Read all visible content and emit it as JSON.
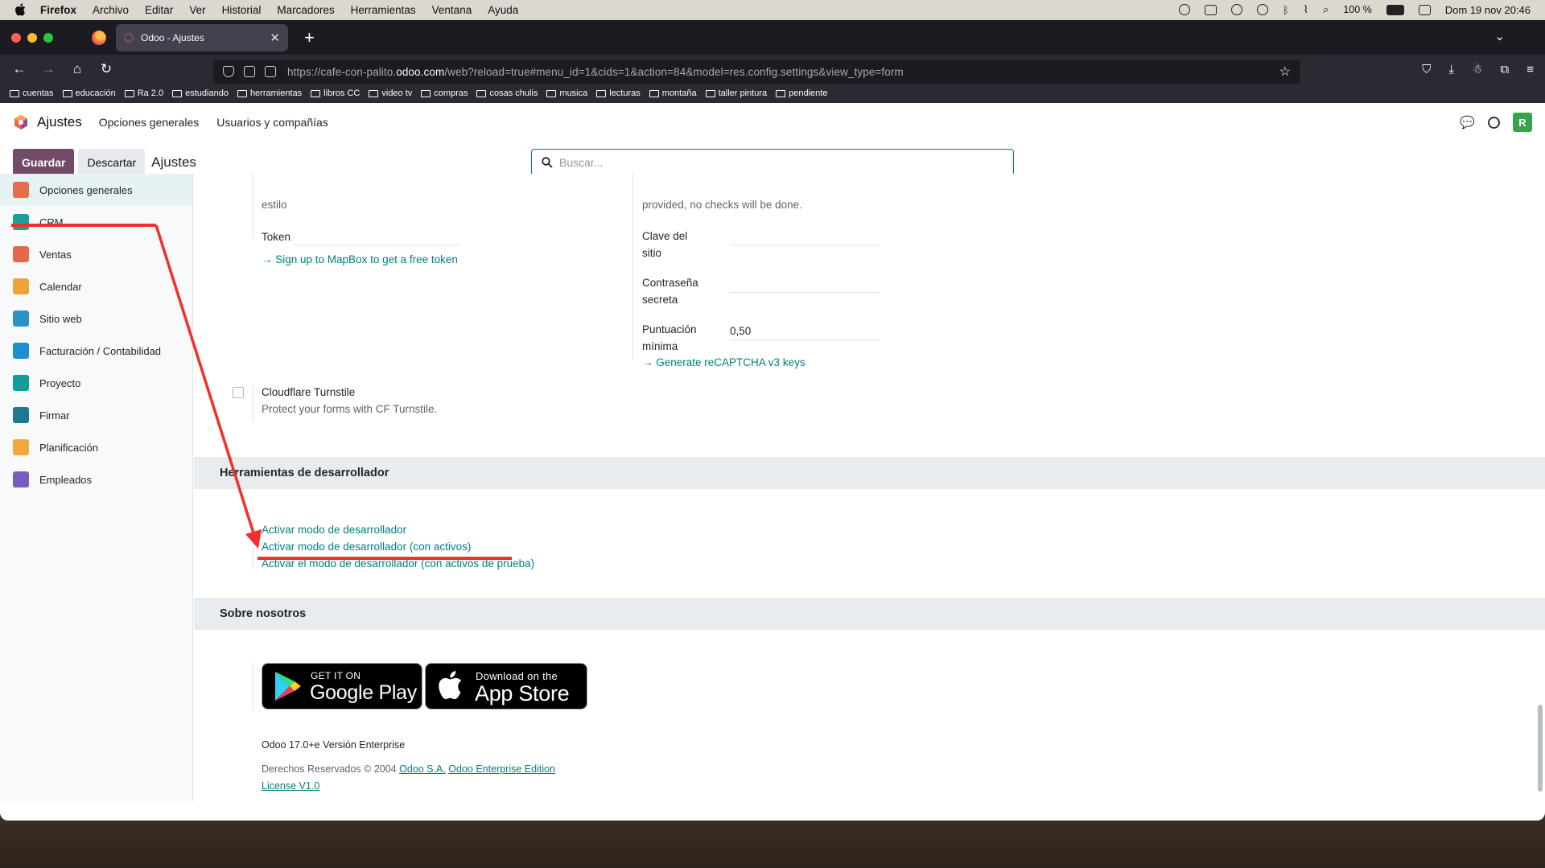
{
  "macos_menubar": {
    "app": "Firefox",
    "items": [
      "Archivo",
      "Editar",
      "Ver",
      "Historial",
      "Marcadores",
      "Herramientas",
      "Ventana",
      "Ayuda"
    ],
    "battery": "100 %",
    "datetime": "Dom 19 nov  20:46"
  },
  "browser": {
    "tab_title": "Odoo - Ajustes",
    "url_prefix": "https://cafe-con-palito.",
    "url_domain": "odoo.com",
    "url_suffix": "/web?reload=true#menu_id=1&cids=1&action=84&model=res.config.settings&view_type=form",
    "bookmarks": [
      "cuentas",
      "educación",
      "Ra 2.0",
      "estudiando",
      "herramientas",
      "libros CC",
      "video tv",
      "compras",
      "cosas chulis",
      "musica",
      "lecturas",
      "montaña",
      "taller pintura",
      "pendiente"
    ]
  },
  "odoo": {
    "app_name": "Ajustes",
    "top_menu": [
      "Opciones generales",
      "Usuarios y compañías"
    ],
    "avatar_letter": "R",
    "save_label": "Guardar",
    "discard_label": "Descartar",
    "breadcrumb": "Ajustes",
    "search_placeholder": "Buscar..."
  },
  "sidebar": {
    "items": [
      {
        "label": "Opciones generales",
        "color": "#e46f4c"
      },
      {
        "label": "CRM",
        "color": "#1a9f9a"
      },
      {
        "label": "Ventas",
        "color": "#e4694c"
      },
      {
        "label": "Calendar",
        "color": "#f0a13a"
      },
      {
        "label": "Sitio web",
        "color": "#2a94c9"
      },
      {
        "label": "Facturación / Contabilidad",
        "color": "#1c8fd1"
      },
      {
        "label": "Proyecto",
        "color": "#0e9f96"
      },
      {
        "label": "Firmar",
        "color": "#1d7a8c"
      },
      {
        "label": "Planificación",
        "color": "#f3a73d"
      },
      {
        "label": "Empleados",
        "color": "#7a5cc0"
      }
    ]
  },
  "settings": {
    "mapbox_partial": "estilo",
    "token_label": "Token",
    "mapbox_link": "→ Sign up to MapBox to get a free token",
    "recaptcha_partial": "provided, no checks will be done.",
    "site_key_label_1": "Clave del",
    "site_key_label_2": "sitio",
    "secret_label_1": "Contraseña",
    "secret_label_2": "secreta",
    "score_label_1": "Puntuación",
    "score_label_2": "mínima",
    "score_value": "0,50",
    "recaptcha_link": "→ Generate reCAPTCHA v3 keys",
    "turnstile_title": "Cloudflare Turnstile",
    "turnstile_desc": "Protect your forms with CF Turnstile."
  },
  "dev_tools": {
    "section_title": "Herramientas de desarrollador",
    "links": [
      "Activar modo de desarrollador",
      "Activar modo de desarrollador (con activos)",
      "Activar el modo de desarrollador (con activos de prueba)"
    ]
  },
  "about": {
    "section_title": "Sobre nosotros",
    "google_small": "GET IT ON",
    "google_big": "Google Play",
    "apple_small": "Download on the",
    "apple_big": "App Store",
    "version": "Odoo 17.0+e Versión Enterprise",
    "copyright": "Derechos Reservados © 2004",
    "company_link": "Odoo S.A.",
    "license_link": "Odoo Enterprise Edition",
    "license_link_2": "License V1.0"
  },
  "annotation": {
    "color": "#f0302a"
  }
}
